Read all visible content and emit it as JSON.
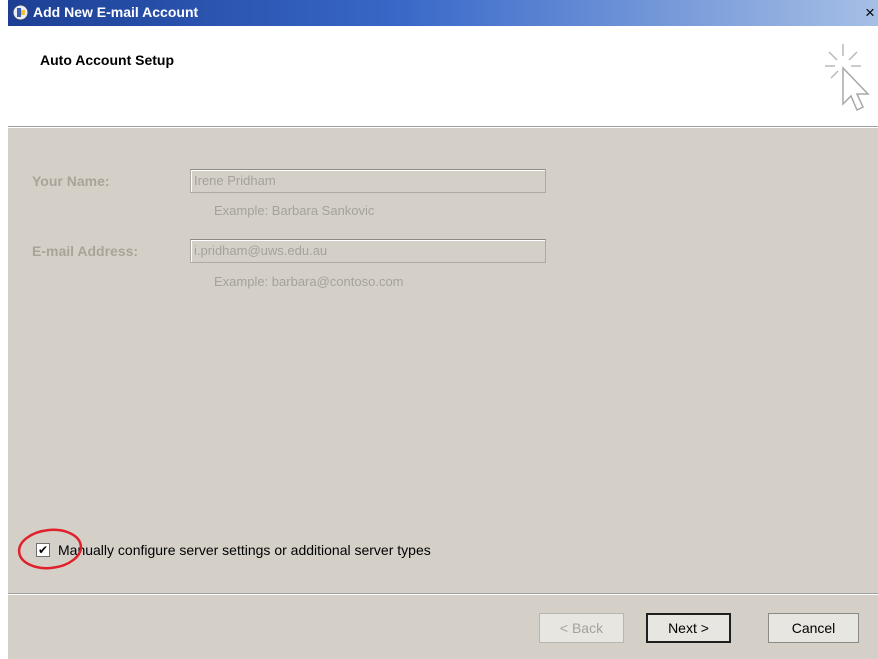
{
  "window": {
    "title": "Add New E-mail Account",
    "close_glyph": "×"
  },
  "header": {
    "title": "Auto Account Setup",
    "icon": "wizard-cursor-sparkle-icon"
  },
  "form": {
    "name_label": "Your Name:",
    "name_value": "Irene Pridham",
    "name_example": "Example: Barbara Sankovic",
    "email_label": "E-mail Address:",
    "email_value": "i.pridham@uws.edu.au",
    "email_example": "Example: barbara@contoso.com",
    "fields_enabled": false
  },
  "manual_config": {
    "checked": true,
    "check_glyph": "✔",
    "label": "Manually configure server settings or additional server types",
    "annotation_color": "#e0202a"
  },
  "buttons": {
    "back": "< Back",
    "next": "Next >",
    "cancel": "Cancel"
  },
  "colors": {
    "titlebar_start": "#1c3f94",
    "dialog_bg": "#d4d0c8",
    "disabled_text": "#a5a299"
  }
}
